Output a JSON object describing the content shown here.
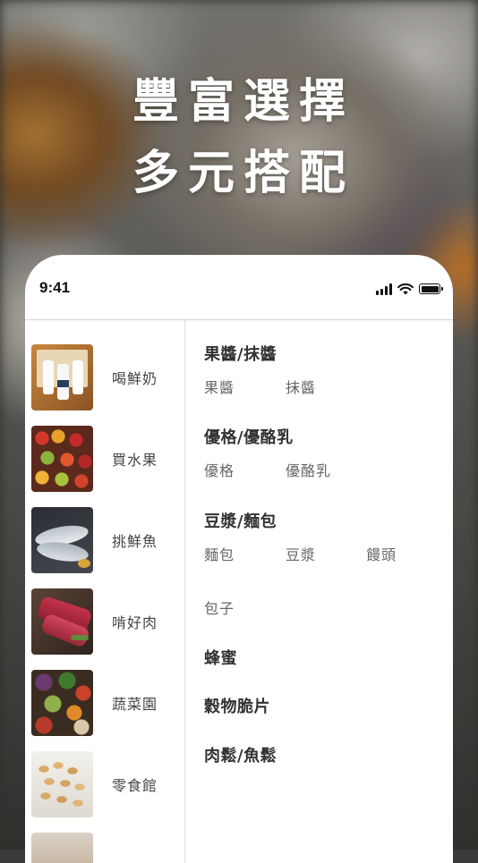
{
  "headline": {
    "line1": "豐富選擇",
    "line2": "多元搭配"
  },
  "status_bar": {
    "time": "9:41",
    "icons": [
      "signal-icon",
      "wifi-icon",
      "battery-icon"
    ]
  },
  "sidebar": {
    "items": [
      {
        "label": "喝鮮奶",
        "thumb": "milk"
      },
      {
        "label": "買水果",
        "thumb": "fruit"
      },
      {
        "label": "挑鮮魚",
        "thumb": "fish"
      },
      {
        "label": "啃好肉",
        "thumb": "meat"
      },
      {
        "label": "蔬菜園",
        "thumb": "vegetables"
      },
      {
        "label": "零食館",
        "thumb": "snacks"
      },
      {
        "label": "",
        "thumb": "partial"
      }
    ]
  },
  "categories": [
    {
      "title": "果醬/抹醬",
      "subs": [
        "果醬",
        "抹醬"
      ]
    },
    {
      "title": "優格/優酪乳",
      "subs": [
        "優格",
        "優酪乳"
      ]
    },
    {
      "title": "豆漿/麵包",
      "subs": [
        "麵包",
        "豆漿",
        "饅頭",
        "包子"
      ]
    },
    {
      "title": "蜂蜜",
      "subs": []
    },
    {
      "title": "穀物脆片",
      "subs": []
    },
    {
      "title": "肉鬆/魚鬆",
      "subs": []
    }
  ]
}
